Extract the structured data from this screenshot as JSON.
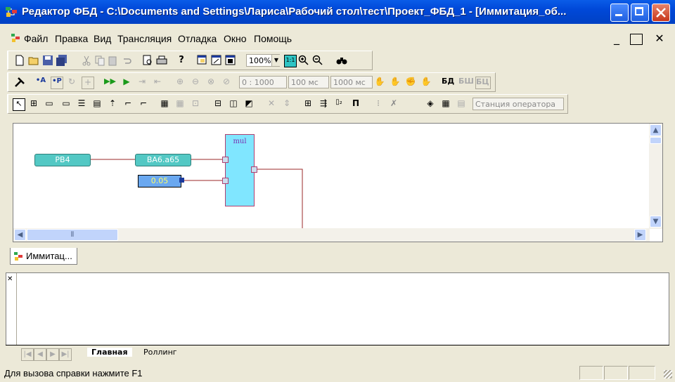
{
  "window": {
    "title": "Редактор ФБД - C:\\Documents and Settings\\Лариса\\Рабочий стол\\тест\\Проект_ФБД_1 - [Иммитация_об..."
  },
  "menu": [
    "Файл",
    "Правка",
    "Вид",
    "Трансляция",
    "Отладка",
    "Окно",
    "Помощь"
  ],
  "toolbar": {
    "zoom": "100%",
    "time_value": "0 : 1000",
    "interval_1": "100 мс",
    "interval_2": "1000 мс",
    "operator_station": "Станция оператора",
    "labels": {
      "bd": "БД",
      "bsh": "БШ",
      "bts": "БЦ"
    }
  },
  "diagram": {
    "input_1": "PB4",
    "input_2": "BA6.a65",
    "constant": "0.05",
    "block": "mul",
    "colors": {
      "wire": "#9b2a2a",
      "block_fill": "#80e6ff",
      "node_fill": "#53c8c4",
      "const_fill": "#6aa8f0",
      "const_text": "#ffff66"
    }
  },
  "document_tab": "Иммитац...",
  "output_tabs": [
    "Главная",
    "Роллинг"
  ],
  "status": {
    "text": "Для вызова справки нажмите F1"
  }
}
